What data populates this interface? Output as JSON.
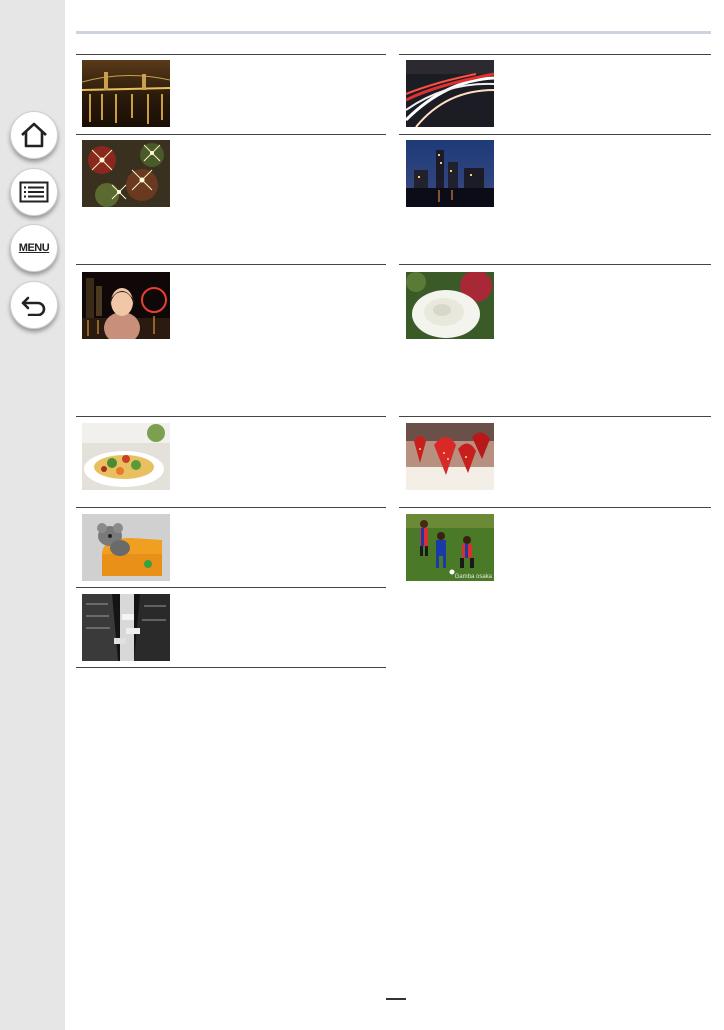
{
  "navigation": {
    "home_icon": "home-icon",
    "contents_icon": "list-icon",
    "menu_label": "MENU",
    "back_icon": "back-arrow-icon"
  },
  "scenes": [
    {
      "name": "night-bridge-scene",
      "icon": "photo"
    },
    {
      "name": "light-trails-scene",
      "icon": "photo"
    },
    {
      "name": "sparkle-lights-scene",
      "icon": "photo"
    },
    {
      "name": "city-night-scene",
      "icon": "photo"
    },
    {
      "name": "night-portrait-scene",
      "icon": "photo"
    },
    {
      "name": "white-flower-scene",
      "icon": "photo"
    },
    {
      "name": "food-plate-scene",
      "icon": "photo"
    },
    {
      "name": "strawberry-cake-scene",
      "icon": "photo"
    },
    {
      "name": "koala-toy-scene",
      "icon": "photo"
    },
    {
      "name": "soccer-players-scene",
      "icon": "photo"
    },
    {
      "name": "monochrome-street-scene",
      "icon": "photo"
    }
  ],
  "photo_watermark": "Gamba osaka",
  "colors": {
    "sidebar": "#e6e6e6",
    "top_rule": "#cdd3e0",
    "cell_rule": "#444444"
  }
}
